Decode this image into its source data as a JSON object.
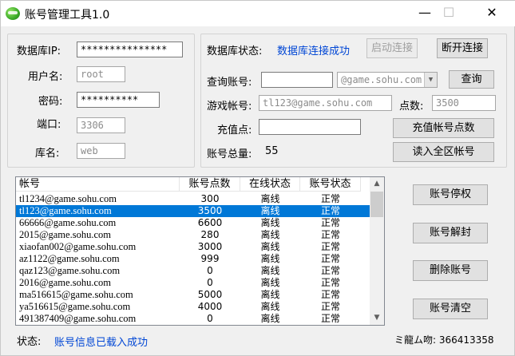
{
  "window": {
    "title": "账号管理工具1.0",
    "minimize_glyph": "—",
    "maximize_glyph": "☐",
    "close_glyph": "✕",
    "app_icon": "green-sphere-icon"
  },
  "db": {
    "ip_label": "数据库IP:",
    "ip_value": "***************",
    "user_label": "用户名:",
    "user_value": "root",
    "password_label": "密码:",
    "password_value": "**********",
    "port_label": "端口:",
    "port_value": "3306",
    "dbname_label": "库名:",
    "dbname_value": "web"
  },
  "status_panel": {
    "db_status_label": "数据库状态:",
    "db_status_value": "数据库连接成功",
    "connect_button": "启动连接",
    "disconnect_button": "断开连接",
    "query_account_label": "查询账号:",
    "query_account_value": "",
    "domain_select": "@game.sohu.com",
    "query_button": "查询",
    "game_account_label": "游戏帐号:",
    "game_account_value": "tl123@game.sohu.com",
    "points_label": "点数:",
    "points_value": "3500",
    "recharge_label": "充值点:",
    "recharge_value": "",
    "recharge_button": "充值帐号点数",
    "total_label": "账号总量:",
    "total_value": "55",
    "load_all_button": "读入全区帐号"
  },
  "table": {
    "columns": [
      "帐号",
      "账号点数",
      "在线状态",
      "账号状态"
    ],
    "rows": [
      [
        "tl1234@game.sohu.com",
        "300",
        "离线",
        "正常"
      ],
      [
        "tl123@game.sohu.com",
        "3500",
        "离线",
        "正常"
      ],
      [
        "66666@game.sohu.com",
        "6600",
        "离线",
        "正常"
      ],
      [
        "2015@game.sohu.com",
        "280",
        "离线",
        "正常"
      ],
      [
        "xiaofan002@game.sohu.com",
        "3000",
        "离线",
        "正常"
      ],
      [
        "az1122@game.sohu.com",
        "999",
        "离线",
        "正常"
      ],
      [
        "qaz123@game.sohu.com",
        "0",
        "离线",
        "正常"
      ],
      [
        "2016@game.sohu.com",
        "0",
        "离线",
        "正常"
      ],
      [
        "ma516615@game.sohu.com",
        "5000",
        "离线",
        "正常"
      ],
      [
        "ya516615@game.sohu.com",
        "4000",
        "离线",
        "正常"
      ],
      [
        "491387409@game.sohu.com",
        "0",
        "离线",
        "正常"
      ]
    ],
    "selected_row": 1
  },
  "actions": {
    "disable_button": "账号停权",
    "unban_button": "账号解封",
    "delete_button": "删除账号",
    "clear_button": "账号清空"
  },
  "statusbar": {
    "label": "状态:",
    "message": "账号信息已载入成功",
    "contact": "ミ龍ム吻: 366413358"
  }
}
